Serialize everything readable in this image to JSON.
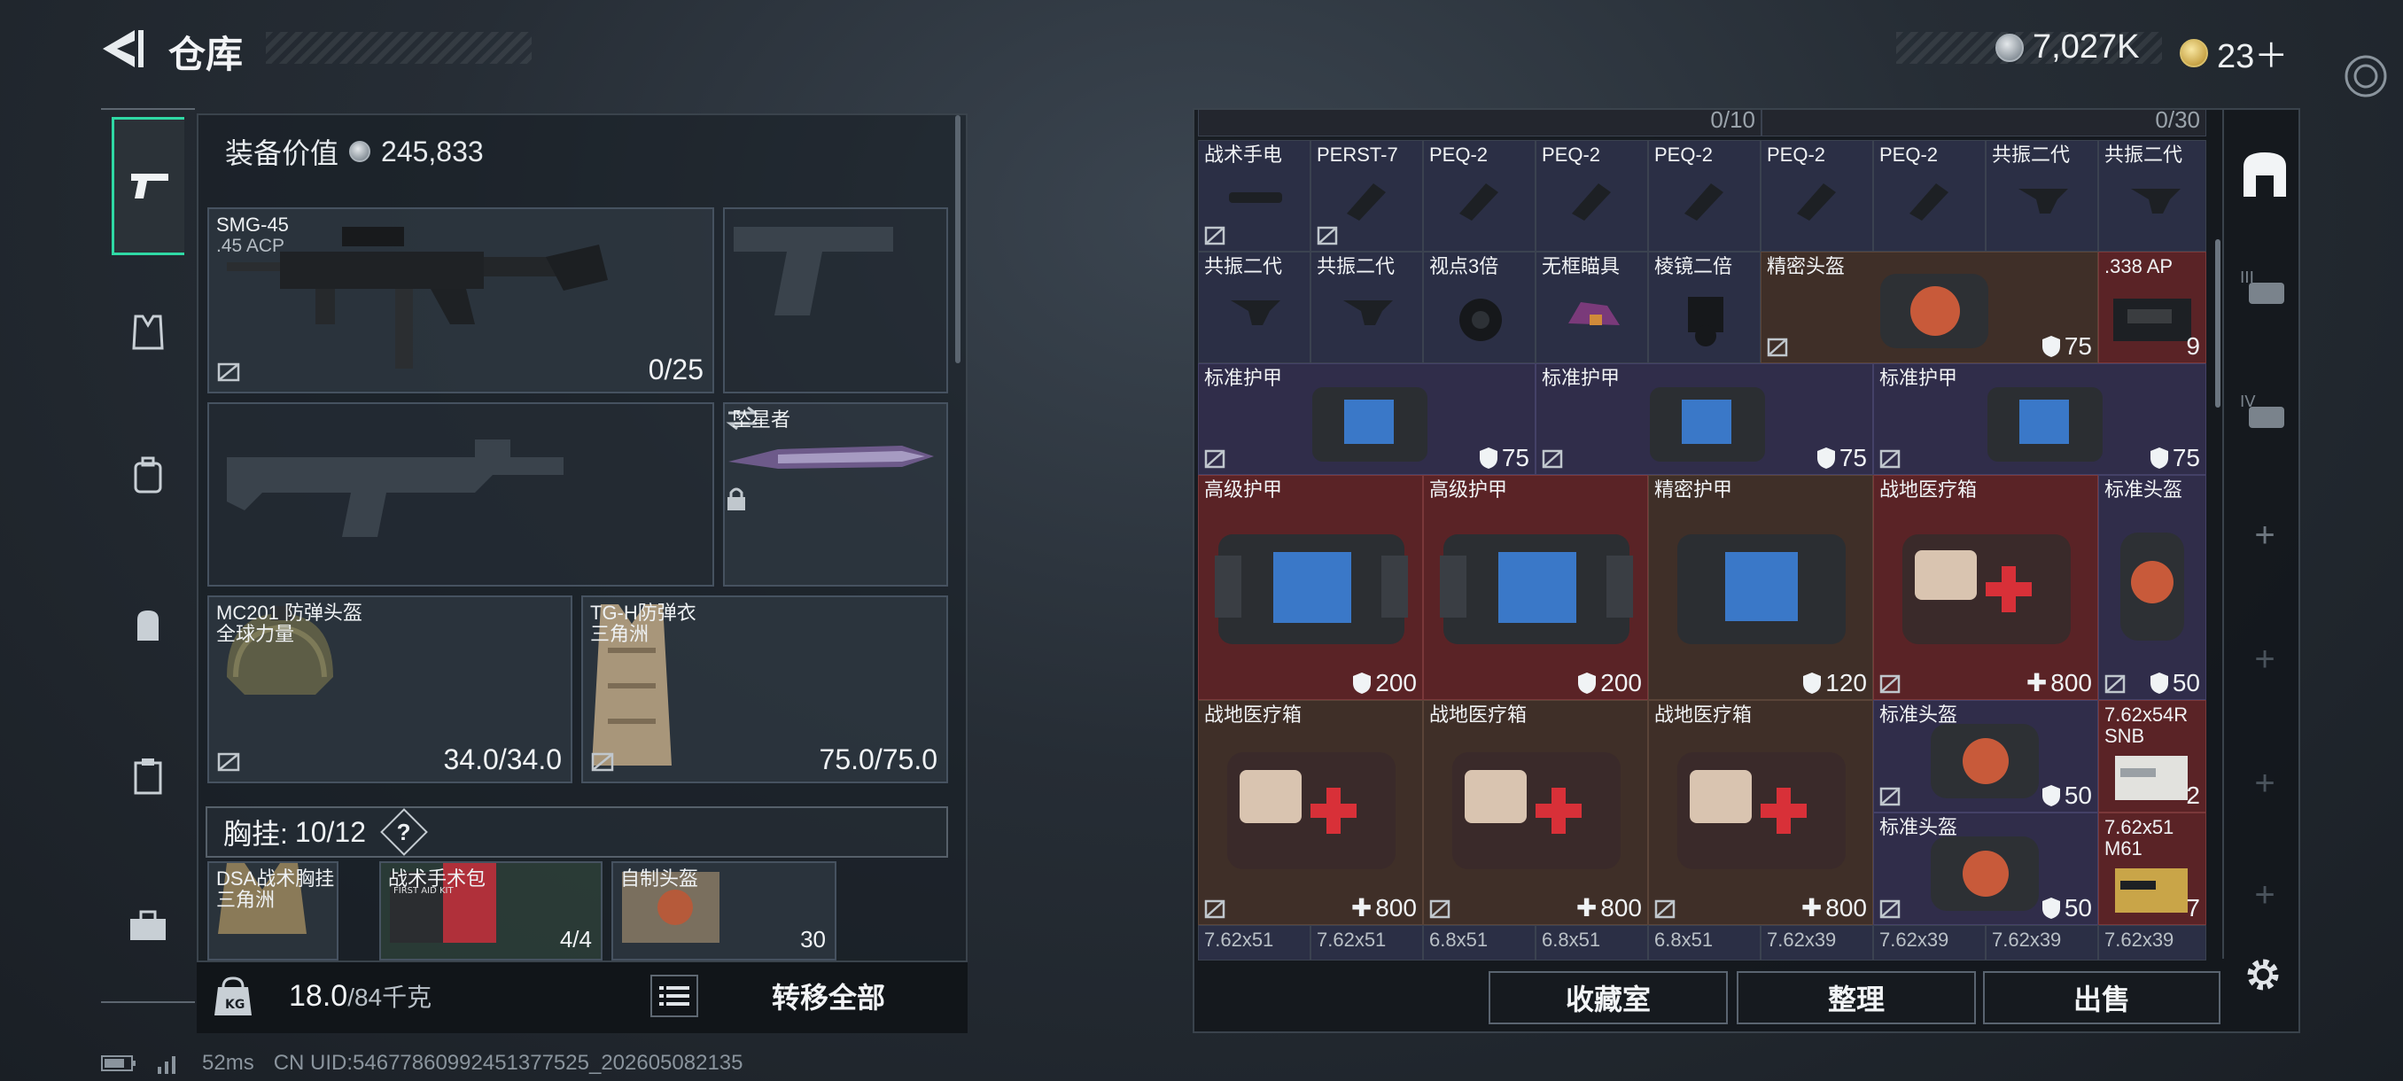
{
  "header": {
    "title": "仓库",
    "currency_silver": "7,027K",
    "currency_gold": "23＋"
  },
  "loadout": {
    "equip_value_label": "装备价值",
    "equip_value": "245,833",
    "primary": {
      "name": "SMG-45",
      "ammo": ".45 ACP",
      "value": "0/25"
    },
    "melee": {
      "name": "坠星者"
    },
    "helmet": {
      "name": "MC201 防弹头盔",
      "sub": "全球力量",
      "value": "34.0/34.0"
    },
    "armor": {
      "name": "TG-H防弹衣",
      "sub": "三角洲",
      "value": "75.0/75.0"
    },
    "rig": {
      "label": "胸挂:",
      "value": "10/12",
      "help": "?"
    },
    "rig_items": [
      {
        "name": "DSA战术胸挂",
        "sub": "三角洲"
      },
      {
        "name": "战术手术包",
        "value": "4/4"
      },
      {
        "name": "自制头盔",
        "value": "30"
      }
    ],
    "weight": "18.0",
    "weight_max": "/84千克",
    "transfer_all": "转移全部"
  },
  "status": {
    "ping": "52ms",
    "uid": "CN UID:546778609924513775​25_202605082135"
  },
  "stash": {
    "top_counts": [
      "0/10",
      "0/30"
    ],
    "rows": {
      "r1": [
        "战术手电",
        "PERST-7",
        "PEQ-2",
        "PEQ-2",
        "PEQ-2",
        "PEQ-2",
        "PEQ-2",
        "共振二代",
        "共振二代"
      ],
      "r2": [
        "共振二代",
        "共振二代",
        "视点3倍",
        "无框瞄具",
        "棱镜二倍",
        "精密头盔",
        ".338 AP"
      ],
      "r2_values": {
        "helmet": "75",
        "ammo": "9"
      },
      "r3": [
        "标准护甲",
        "标准护甲",
        "标准护甲"
      ],
      "r3_values": [
        "75",
        "75",
        "75"
      ],
      "r4": [
        "高级护甲",
        "高级护甲",
        "精密护甲",
        "战地医疗箱",
        "标准头盔"
      ],
      "r4_values": [
        "200",
        "200",
        "120",
        "800",
        "50"
      ],
      "r5": [
        "战地医疗箱",
        "战地医疗箱",
        "战地医疗箱",
        "标准头盔",
        "7.62x54R SNB"
      ],
      "r5_values": [
        "800",
        "800",
        "800",
        "50",
        "2"
      ],
      "r6": [
        "标准头盔",
        "7.62x51 M61"
      ],
      "r6_values": [
        "50",
        "7"
      ],
      "r7": [
        "7.62x51",
        "7.62x51",
        "6.8x51",
        "6.8x51",
        "6.8x51",
        "7.62x39",
        "7.62x39",
        "7.62x39",
        "7.62x39"
      ]
    },
    "actions": [
      "收藏室",
      "整理",
      "出售"
    ]
  },
  "colors": {
    "accent": "#2fd9a5",
    "red_cell": "#5a2326",
    "purple_cell": "#302d4a"
  }
}
